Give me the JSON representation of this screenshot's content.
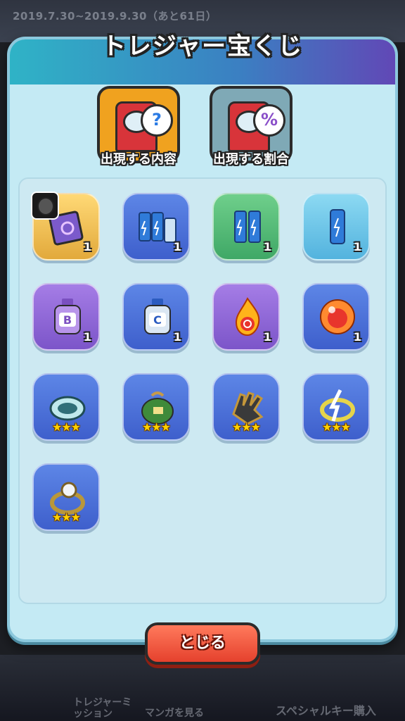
{
  "background": {
    "date_range": "2019.7.30~2019.9.30（あと61日）",
    "bottom_left_label": "トレジャーミッション",
    "bottom_center_label": "マンガを見る",
    "bottom_right_label": "スペシャルキー購入"
  },
  "modal": {
    "title": "トレジャー宝くじ",
    "buttons": [
      {
        "label": "出現する内容",
        "bubble": "?",
        "color": "#f0a21f"
      },
      {
        "label": "出現する割合",
        "bubble": "%",
        "color": "#7fa9b6"
      }
    ],
    "items": [
      {
        "icon": "spellbook-icon",
        "qty": "1",
        "stars": "",
        "bg": "gold",
        "badge": true
      },
      {
        "icon": "battery-triple-icon",
        "qty": "1",
        "stars": "",
        "bg": "blue"
      },
      {
        "icon": "battery-double-icon",
        "qty": "1",
        "stars": "",
        "bg": "green"
      },
      {
        "icon": "battery-single-icon",
        "qty": "1",
        "stars": "",
        "bg": "cyan"
      },
      {
        "icon": "potion-b-icon",
        "qty": "1",
        "stars": "",
        "bg": "purple"
      },
      {
        "icon": "potion-c-icon",
        "qty": "1",
        "stars": "",
        "bg": "blue"
      },
      {
        "icon": "fire-orb-icon",
        "qty": "1",
        "stars": "",
        "bg": "purple"
      },
      {
        "icon": "red-orb-icon",
        "qty": "1",
        "stars": "",
        "bg": "blue"
      },
      {
        "icon": "bracelet-icon",
        "qty": "",
        "stars": "★★★",
        "bg": "blue"
      },
      {
        "icon": "clover-bag-icon",
        "qty": "",
        "stars": "★★★",
        "bg": "blue"
      },
      {
        "icon": "claw-glove-icon",
        "qty": "",
        "stars": "★★★",
        "bg": "blue"
      },
      {
        "icon": "gold-ring-icon",
        "qty": "",
        "stars": "★★★",
        "bg": "blue"
      },
      {
        "icon": "pearl-ring-icon",
        "qty": "",
        "stars": "★★★",
        "bg": "blue"
      }
    ],
    "close_label": "とじる"
  }
}
